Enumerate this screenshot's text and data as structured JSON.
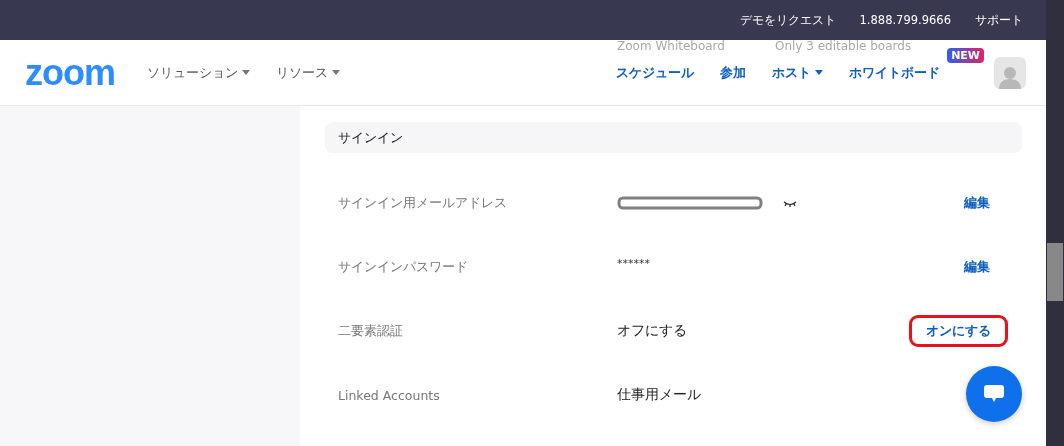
{
  "top_bar": {
    "links": [
      "デモをリクエスト",
      "1.888.799.9666",
      "サポート"
    ]
  },
  "nav": {
    "logo": "zoom",
    "menus": [
      {
        "label": "ソリューション",
        "dropdown": true
      },
      {
        "label": "リソース",
        "dropdown": true
      }
    ],
    "background_notice": [
      "Zoom Whiteboard",
      "Only 3 editable boards"
    ],
    "actions": [
      {
        "label": "スケジュール",
        "dropdown": false
      },
      {
        "label": "参加",
        "dropdown": false
      },
      {
        "label": "ホスト",
        "dropdown": true
      },
      {
        "label": "ホワイトボード",
        "dropdown": false,
        "badge": "NEW"
      }
    ]
  },
  "section": {
    "title": "サインイン",
    "rows": [
      {
        "label": "サインイン用メールアドレス",
        "kind": "redacted",
        "action": "編集",
        "highlighted": false
      },
      {
        "label": "サインインパスワード",
        "kind": "text",
        "value": "******",
        "action": "編集",
        "highlighted": false
      },
      {
        "label": "二要素認証",
        "kind": "text",
        "value": "オフにする",
        "action": "オンにする",
        "highlighted": true
      },
      {
        "label": "Linked Accounts",
        "kind": "text",
        "value": "仕事用メール"
      }
    ]
  }
}
